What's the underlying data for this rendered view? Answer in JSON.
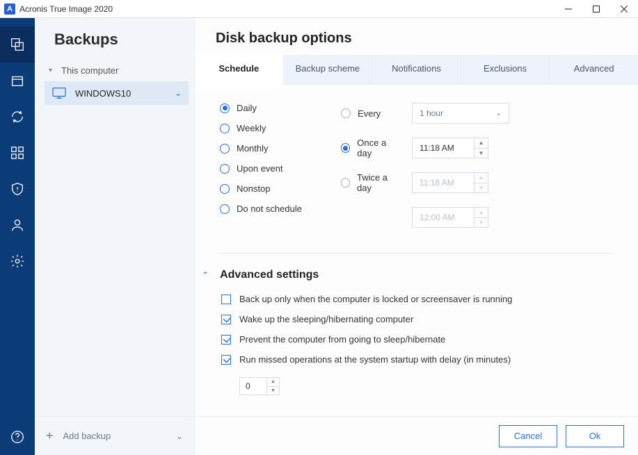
{
  "app": {
    "title": "Acronis True Image 2020",
    "logo_letter": "A"
  },
  "sidebar": {
    "title": "Backups",
    "group_label": "This computer",
    "items": [
      {
        "label": "WINDOWS10"
      }
    ],
    "footer": {
      "add_label": "Add backup"
    }
  },
  "main": {
    "title": "Disk backup options",
    "tabs": [
      "Schedule",
      "Backup scheme",
      "Notifications",
      "Exclusions",
      "Advanced"
    ],
    "active_tab": 0
  },
  "schedule": {
    "period_options": [
      "Daily",
      "Weekly",
      "Monthly",
      "Upon event",
      "Nonstop",
      "Do not schedule"
    ],
    "period_selected": 0,
    "freq_options": [
      "Every",
      "Once a day",
      "Twice a day"
    ],
    "freq_selected": 1,
    "every_value": "1 hour",
    "once_time": "11:18 AM",
    "twice_time1": "11:18 AM",
    "twice_time2": "12:00 AM"
  },
  "advanced": {
    "title": "Advanced settings",
    "options": [
      {
        "label": "Back up only when the computer is locked or screensaver is running",
        "checked": false
      },
      {
        "label": "Wake up the sleeping/hibernating computer",
        "checked": true
      },
      {
        "label": "Prevent the computer from going to sleep/hibernate",
        "checked": true
      },
      {
        "label": "Run missed operations at the system startup with delay (in minutes)",
        "checked": true
      }
    ],
    "delay_value": "0"
  },
  "buttons": {
    "cancel": "Cancel",
    "ok": "Ok"
  }
}
